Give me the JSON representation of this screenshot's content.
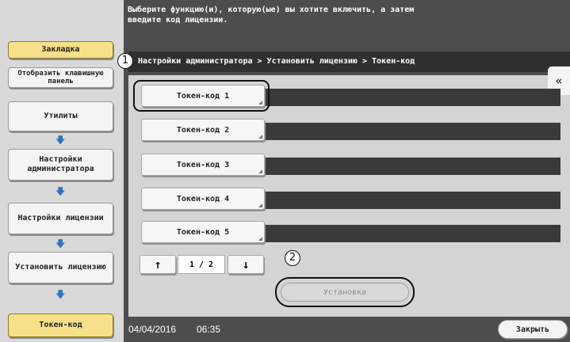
{
  "message": "Выберите функцию(и), которую(ые) вы хотите включить, а затем\nвведите код лицензии.",
  "sidebar": {
    "bookmark": "Закладка",
    "show_keypad": "Отобразить клавишную панель",
    "steps": [
      "Утилиты",
      "Настройки администратора",
      "Настройки лицензии",
      "Установить лицензию",
      "Токен-код"
    ],
    "arrow_icon": "arrow-down-icon"
  },
  "breadcrumb": "Настройки администратора > Установить лицензию > Токен-код",
  "tokens": [
    "Токен-код 1",
    "Токен-код 2",
    "Токен-код 3",
    "Токен-код 4",
    "Токен-код 5"
  ],
  "callouts": [
    "1",
    "2"
  ],
  "pager": {
    "up": "↑",
    "page": "1 / 2",
    "down": "↓"
  },
  "setup_button": "Установка",
  "expand_icon": "«",
  "footer": {
    "date": "04/04/2016",
    "time": "06:35",
    "close": "Закрыть"
  }
}
